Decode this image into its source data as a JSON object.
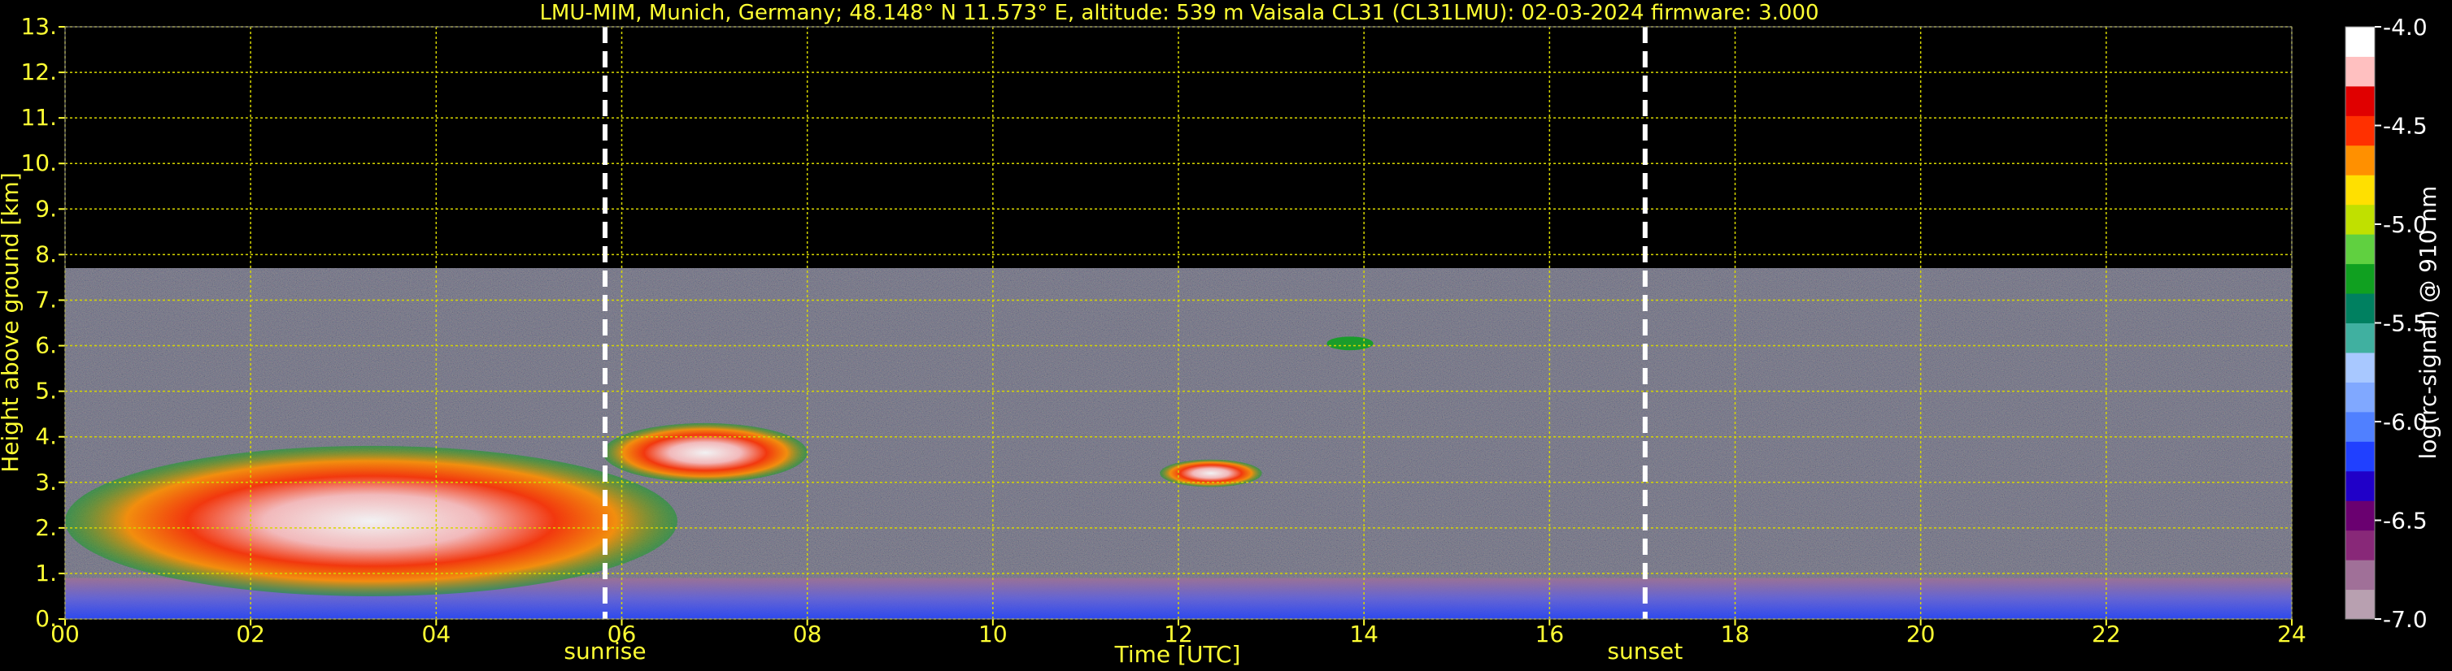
{
  "chart_data": {
    "type": "heatmap",
    "title": "LMU-MIM, Munich, Germany; 48.148° N 11.573° E, altitude: 539 m    Vaisala CL31 (CL31LMU): 02-03-2024    firmware: 3.000",
    "xlabel": "Time [UTC]",
    "ylabel": "Height above ground [km]",
    "xlim": [
      0,
      24
    ],
    "ylim": [
      0,
      13
    ],
    "x_ticks": [
      "00",
      "02",
      "04",
      "06",
      "08",
      "10",
      "12",
      "14",
      "16",
      "18",
      "20",
      "22",
      "24"
    ],
    "y_ticks": [
      "0.",
      "1.",
      "2.",
      "3.",
      "4.",
      "5.",
      "6.",
      "7.",
      "8.",
      "9.",
      "10.",
      "11.",
      "12.",
      "13."
    ],
    "grid": true,
    "grid_color": "#d6d600",
    "markers": [
      {
        "label": "sunrise",
        "x": 5.82
      },
      {
        "label": "sunset",
        "x": 17.03
      }
    ],
    "colorbar": {
      "label": "log(rc-signal) @ 910 nm",
      "range": [
        -7.0,
        -4.0
      ],
      "ticks": [
        "-4.0",
        "-4.5",
        "-5.0",
        "-5.5",
        "-6.0",
        "-6.5",
        "-7.0"
      ],
      "colors": [
        "#b8a0b0",
        "#a07098",
        "#882878",
        "#6a0070",
        "#2000c8",
        "#2040ff",
        "#5080ff",
        "#80a8ff",
        "#a8c8ff",
        "#40b0a0",
        "#008060",
        "#10a020",
        "#60d040",
        "#c0e000",
        "#ffe000",
        "#ff9000",
        "#ff3000",
        "#e00000",
        "#ffc0c0",
        "#ffffff"
      ]
    },
    "features": [
      {
        "name": "boundary layer aerosol",
        "x_range": [
          0,
          24
        ],
        "height_km": [
          0,
          0.9
        ],
        "level": -6.0
      },
      {
        "name": "low cloud layer",
        "x_range": [
          0,
          6.6
        ],
        "height_km": [
          0.5,
          3.8
        ],
        "level": -4.6
      },
      {
        "name": "cloud near sunrise",
        "x_range": [
          5.8,
          8.0
        ],
        "height_km": [
          3.0,
          4.3
        ],
        "level": -4.2
      },
      {
        "name": "midday cloud",
        "x_range": [
          11.8,
          12.9
        ],
        "height_km": [
          2.9,
          3.5
        ],
        "level": -4.6
      },
      {
        "name": "thin cloud",
        "x_range": [
          13.6,
          14.1
        ],
        "height_km": [
          5.9,
          6.2
        ],
        "level": -5.2
      },
      {
        "name": "noise ceiling",
        "x_range": [
          0,
          24
        ],
        "height_km": [
          0.9,
          7.7
        ],
        "level": -6.5
      }
    ]
  }
}
